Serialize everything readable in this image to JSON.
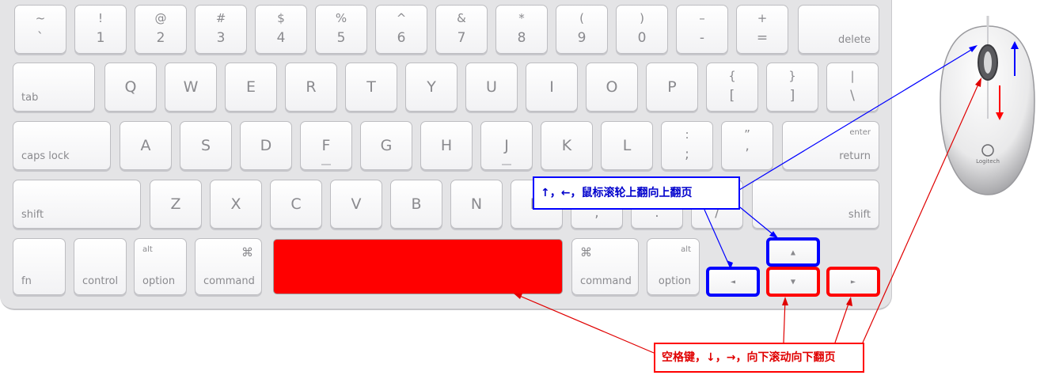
{
  "keyboard": {
    "row1": [
      {
        "top": "~",
        "bot": "`"
      },
      {
        "top": "!",
        "bot": "1"
      },
      {
        "top": "@",
        "bot": "2"
      },
      {
        "top": "#",
        "bot": "3"
      },
      {
        "top": "$",
        "bot": "4"
      },
      {
        "top": "%",
        "bot": "5"
      },
      {
        "top": "^",
        "bot": "6"
      },
      {
        "top": "&",
        "bot": "7"
      },
      {
        "top": "*",
        "bot": "8"
      },
      {
        "top": "(",
        "bot": "9"
      },
      {
        "top": ")",
        "bot": "0"
      },
      {
        "top": "–",
        "bot": "-"
      },
      {
        "top": "+",
        "bot": "="
      }
    ],
    "delete": "delete",
    "tab": "tab",
    "row2": [
      "Q",
      "W",
      "E",
      "R",
      "T",
      "Y",
      "U",
      "I",
      "O",
      "P"
    ],
    "row2_brackets": [
      {
        "top": "{",
        "bot": "["
      },
      {
        "top": "}",
        "bot": "]"
      },
      {
        "top": "|",
        "bot": "\\"
      }
    ],
    "caps_lock": "caps lock",
    "row3": [
      "A",
      "S",
      "D",
      "F",
      "G",
      "H",
      "J",
      "K",
      "L"
    ],
    "row3_punct": [
      {
        "top": ":",
        "bot": ";"
      },
      {
        "top": "”",
        "bot": "’"
      }
    ],
    "enter": "enter",
    "return": "return",
    "shift_left": "shift",
    "row4": [
      "Z",
      "X",
      "C",
      "V",
      "B",
      "N"
    ],
    "row4_hidden": [
      "M"
    ],
    "row4_punct": [
      {
        "top": "",
        "bot": ","
      },
      {
        "top": "",
        "bot": "."
      },
      {
        "top": "",
        "bot": "/"
      }
    ],
    "shift_right": "shift",
    "fn": "fn",
    "control": "control",
    "alt": "alt",
    "option": "option",
    "cmd_symbol": "⌘",
    "command": "command",
    "arrow_up": "▲",
    "arrow_down": "▼",
    "arrow_left": "◄",
    "arrow_right": "►"
  },
  "mouse": {
    "brand": "Logitech",
    "up_arrow_color": "#0000ff",
    "down_arrow_color": "#ff0000"
  },
  "annotations": {
    "scroll_up_label": "↑，←，鼠标滚轮上翻向上翻页",
    "scroll_down_label": "空格键，↓，→，向下滚动向下翻页",
    "up_color": "#0000ff",
    "down_color": "#ff0000"
  }
}
